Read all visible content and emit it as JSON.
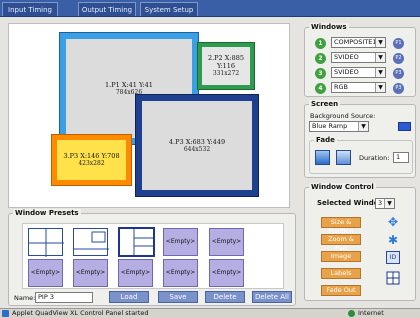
{
  "tabs": [
    "Input Timing",
    "Output Timing",
    "System Setup"
  ],
  "canvas": {
    "windows": [
      {
        "label": "1.P1 X:41 Y:41",
        "size": "784x626",
        "fill": "#3aa0e6",
        "inner": "#dcdcdc"
      },
      {
        "label": "2.P2 X:885 Y:116",
        "size": "331x272",
        "fill": "#2e9b4e",
        "inner": "#e6e6e6"
      },
      {
        "label": "3.P3 X:146 Y:708",
        "size": "423x282",
        "fill": "#ff8a00",
        "inner": "#ffe14a"
      },
      {
        "label": "4.P3 X:683 Y:449",
        "size": "644x532",
        "fill": "#1f3f8f",
        "inner": "#dcdcdc"
      }
    ]
  },
  "windows_panel": {
    "title": "Windows",
    "rows": [
      {
        "num": "1",
        "source": "COMPOSITE1",
        "badge": "P1"
      },
      {
        "num": "2",
        "source": "SVIDEO",
        "badge": "P2"
      },
      {
        "num": "3",
        "source": "SVIDEO",
        "badge": "P3"
      },
      {
        "num": "4",
        "source": "RGB",
        "badge": "P3"
      }
    ]
  },
  "screen_panel": {
    "title": "Screen",
    "bg_label": "Background Source:",
    "bg_value": "Blue Ramp",
    "bg_color": "#2a5bd0",
    "fade_title": "Fade",
    "duration_label": "Duration:",
    "duration_value": "1"
  },
  "presets_panel": {
    "title": "Window Presets",
    "empty_label": "<Empty>",
    "name_label": "Name:",
    "name_value": "PIP 3",
    "buttons": {
      "load": "Load",
      "save": "Save",
      "delete": "Delete",
      "delete_all": "Delete All"
    }
  },
  "window_control": {
    "title": "Window Control",
    "selected_label": "Selected Window:",
    "selected_value": "3",
    "buttons": [
      "Size & Position",
      "Zoom & Pan",
      "Image",
      "Labels",
      "Fade Out"
    ],
    "side_icon": "ID"
  },
  "status": {
    "left": "Applet QuadView XL Control Panel started",
    "zone": "Internet"
  }
}
